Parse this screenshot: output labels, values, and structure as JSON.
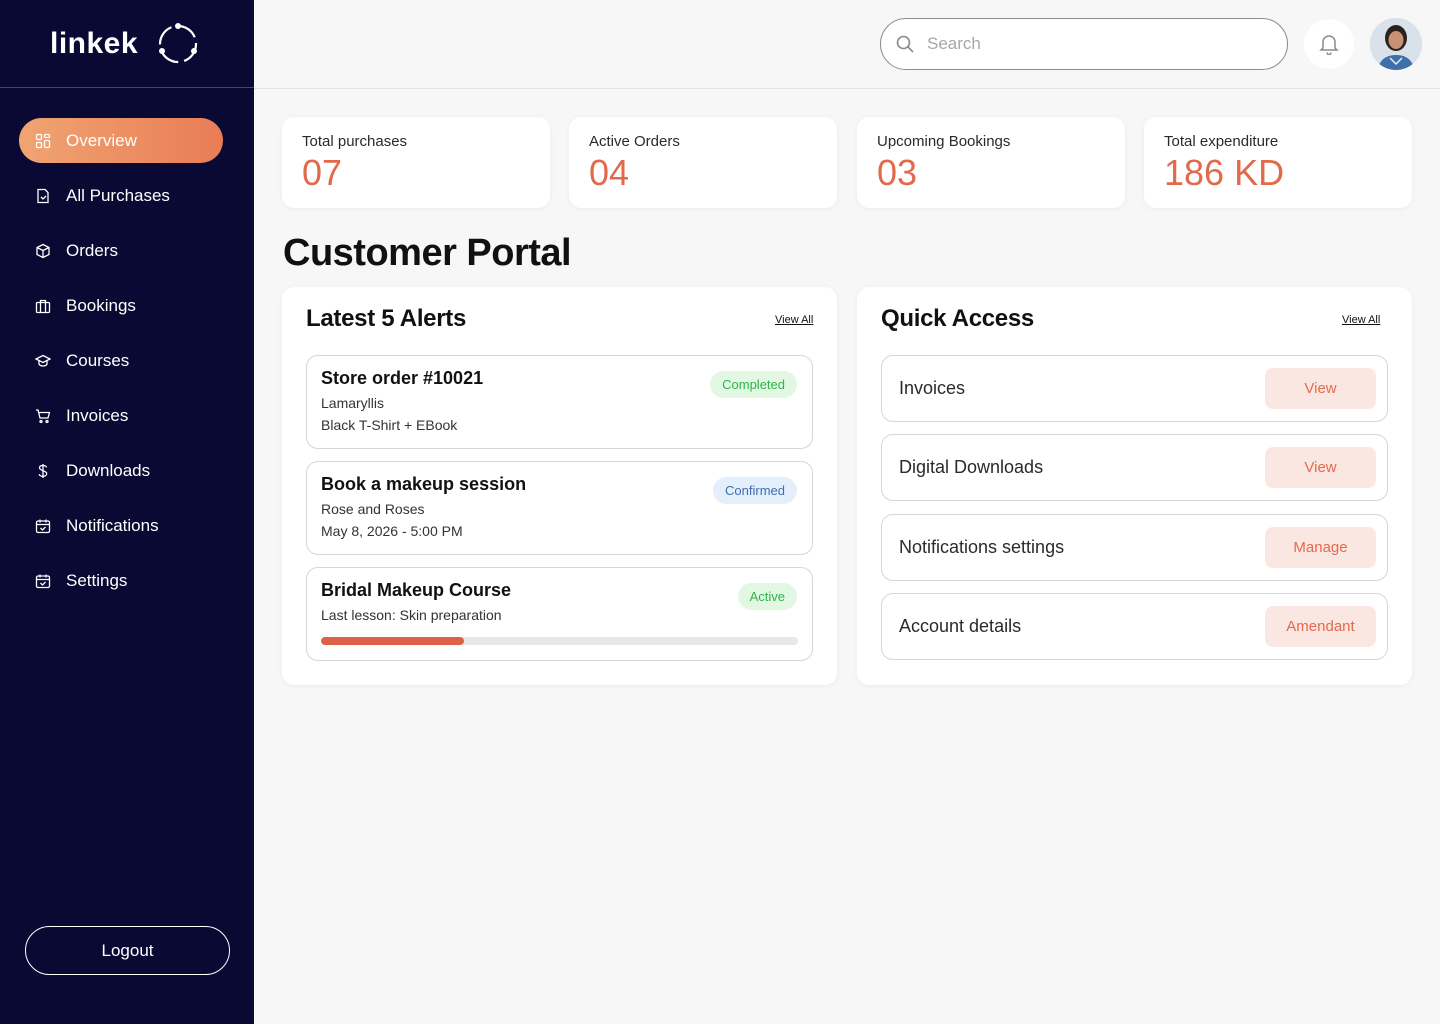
{
  "brand": {
    "name": "linkek"
  },
  "sidebar": {
    "items": [
      {
        "label": "Overview",
        "icon": "grid-icon"
      },
      {
        "label": "All Purchases",
        "icon": "document-icon"
      },
      {
        "label": "Orders",
        "icon": "box-icon"
      },
      {
        "label": "Bookings",
        "icon": "briefcase-icon"
      },
      {
        "label": "Courses",
        "icon": "graduation-cap-icon"
      },
      {
        "label": "Invoices",
        "icon": "cart-icon"
      },
      {
        "label": "Downloads",
        "icon": "dollar-icon"
      },
      {
        "label": "Notifications",
        "icon": "calendar-check-icon"
      },
      {
        "label": "Settings",
        "icon": "calendar-check-icon"
      }
    ],
    "active_index": 0,
    "logout_label": "Logout"
  },
  "header": {
    "search_placeholder": "Search"
  },
  "stats": [
    {
      "label": "Total purchases",
      "value": "07"
    },
    {
      "label": "Active Orders",
      "value": "04"
    },
    {
      "label": "Upcoming Bookings",
      "value": "03"
    },
    {
      "label": "Total expenditure",
      "value": "186 KD"
    }
  ],
  "page_title": "Customer Portal",
  "alerts_panel": {
    "title": "Latest 5 Alerts",
    "view_all": "View All",
    "items": [
      {
        "title": "Store order #10021",
        "line1": "Lamaryllis",
        "line2": "Black T-Shirt + EBook",
        "badge": "Completed"
      },
      {
        "title": "Book a makeup session",
        "line1": "Rose and Roses",
        "line2": "May 8, 2026 - 5:00 PM",
        "badge": "Confirmed"
      },
      {
        "title": "Bridal Makeup Course",
        "line1": "Last lesson: Skin preparation",
        "badge": "Active",
        "progress": 0.3
      }
    ]
  },
  "quick_access": {
    "title": "Quick Access",
    "view_all": "View All",
    "items": [
      {
        "label": "Invoices",
        "action": "View"
      },
      {
        "label": "Digital Downloads",
        "action": "View"
      },
      {
        "label": "Notifications settings",
        "action": "Manage"
      },
      {
        "label": "Account details",
        "action": "Amendant"
      }
    ]
  },
  "colors": {
    "sidebar_bg": "#0a0933",
    "accent": "#e06a4a",
    "active_gradient_start": "#f0a472",
    "active_gradient_end": "#e97c55"
  }
}
